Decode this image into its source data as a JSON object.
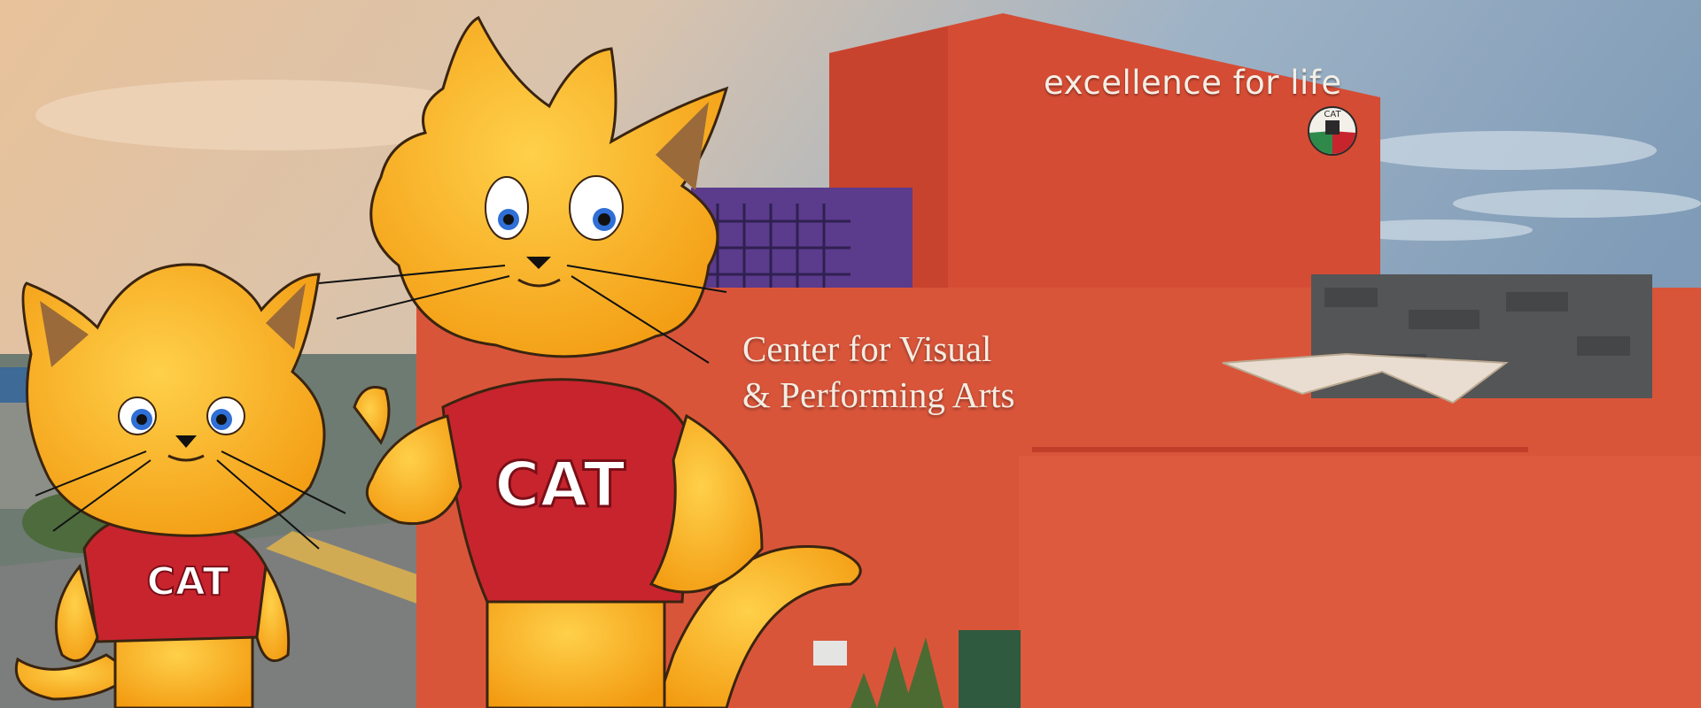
{
  "image": {
    "subject": "campus-banner-with-cat-mascots",
    "building_sign_top": "excellence for life",
    "building_sign_main": [
      "Center for Visual",
      "& Performing Arts"
    ],
    "logo_text": "CAT",
    "mascot_shirt_text": "CAT"
  },
  "colors": {
    "building": "#d9553a",
    "building_dark": "#b8412c",
    "sky_top": "#8fa8bf",
    "sky_warm": "#e9c79e",
    "mascot_fur": "#f5a61d",
    "shirt": "#c8242e"
  }
}
